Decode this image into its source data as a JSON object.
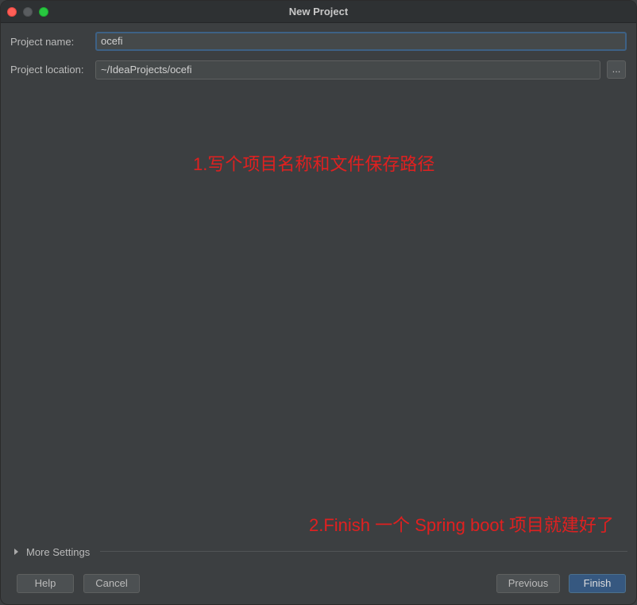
{
  "window": {
    "title": "New Project"
  },
  "form": {
    "name_label": "Project name:",
    "name_value": "ocefi",
    "location_label": "Project location:",
    "location_value": "~/IdeaProjects/ocefi",
    "browse_label": "..."
  },
  "annotations": {
    "step1": "1.写个项目名称和文件保存路径",
    "step2": "2.Finish 一个 Spring boot 项目就建好了",
    "color": "#e02020"
  },
  "more_settings": {
    "label": "More Settings"
  },
  "buttons": {
    "help": "Help",
    "cancel": "Cancel",
    "previous": "Previous",
    "finish": "Finish"
  },
  "colors": {
    "background": "#3c3f41",
    "primary_button": "#365880",
    "focus_border": "#3d6185"
  }
}
